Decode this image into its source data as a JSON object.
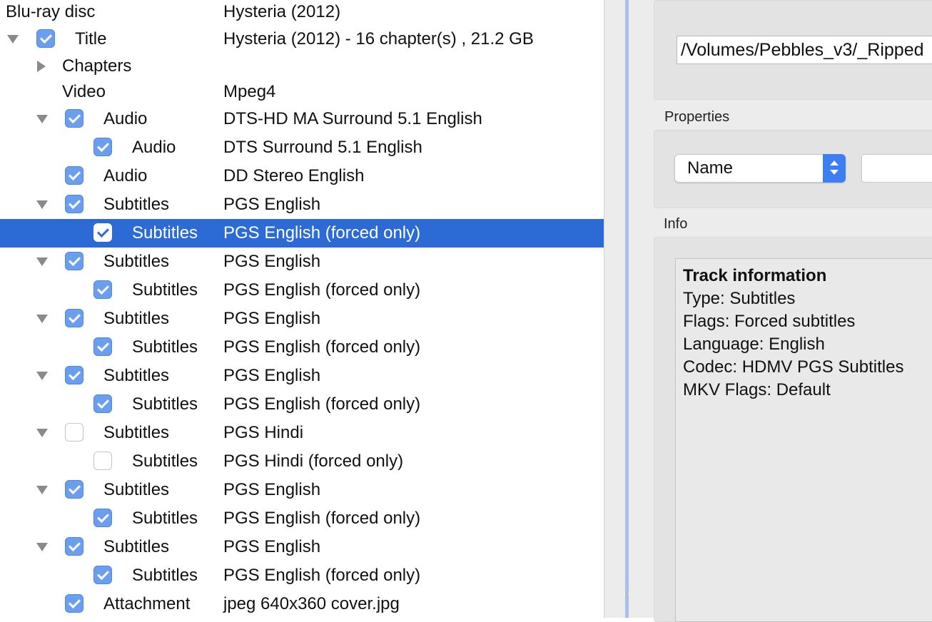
{
  "tree": {
    "rows": [
      {
        "disc": "none",
        "cb": "none",
        "label": "Blu-ray disc",
        "value": "Hysteria (2012)",
        "selected": false
      },
      {
        "disc": "open",
        "cb": "checked",
        "label": "Title",
        "value": "Hysteria (2012) - 16 chapter(s) , 21.2 GB",
        "selected": false
      },
      {
        "disc": "closed",
        "cb": "none",
        "label": "Chapters",
        "value": "",
        "selected": false
      },
      {
        "disc": "none",
        "cb": "none",
        "label": "Video",
        "value": "Mpeg4",
        "selected": false
      },
      {
        "disc": "open",
        "cb": "checked",
        "label": "Audio",
        "value": "DTS-HD MA Surround 5.1 English",
        "selected": false
      },
      {
        "disc": "none",
        "cb": "checked",
        "label": "Audio",
        "value": "DTS Surround 5.1 English",
        "selected": false
      },
      {
        "disc": "none",
        "cb": "checked",
        "label": "Audio",
        "value": "DD Stereo English",
        "selected": false
      },
      {
        "disc": "open",
        "cb": "checked",
        "label": "Subtitles",
        "value": "PGS English",
        "selected": false
      },
      {
        "disc": "none",
        "cb": "checked",
        "label": "Subtitles",
        "value": "PGS English  (forced only)",
        "selected": true
      },
      {
        "disc": "open",
        "cb": "checked",
        "label": "Subtitles",
        "value": "PGS English",
        "selected": false
      },
      {
        "disc": "none",
        "cb": "checked",
        "label": "Subtitles",
        "value": "PGS English  (forced only)",
        "selected": false
      },
      {
        "disc": "open",
        "cb": "checked",
        "label": "Subtitles",
        "value": "PGS English",
        "selected": false
      },
      {
        "disc": "none",
        "cb": "checked",
        "label": "Subtitles",
        "value": "PGS English  (forced only)",
        "selected": false
      },
      {
        "disc": "open",
        "cb": "checked",
        "label": "Subtitles",
        "value": "PGS English",
        "selected": false
      },
      {
        "disc": "none",
        "cb": "checked",
        "label": "Subtitles",
        "value": "PGS English  (forced only)",
        "selected": false
      },
      {
        "disc": "open",
        "cb": "unchecked",
        "label": "Subtitles",
        "value": "PGS Hindi",
        "selected": false
      },
      {
        "disc": "none",
        "cb": "unchecked",
        "label": "Subtitles",
        "value": "PGS Hindi  (forced only)",
        "selected": false
      },
      {
        "disc": "open",
        "cb": "checked",
        "label": "Subtitles",
        "value": "PGS English",
        "selected": false
      },
      {
        "disc": "none",
        "cb": "checked",
        "label": "Subtitles",
        "value": "PGS English  (forced only)",
        "selected": false
      },
      {
        "disc": "open",
        "cb": "checked",
        "label": "Subtitles",
        "value": "PGS English",
        "selected": false
      },
      {
        "disc": "none",
        "cb": "checked",
        "label": "Subtitles",
        "value": "PGS English  (forced only)",
        "selected": false
      },
      {
        "disc": "none",
        "cb": "checked",
        "label": "Attachment",
        "value": "jpeg 640x360 cover.jpg",
        "selected": false
      }
    ]
  },
  "output": {
    "path": "/Volumes/Pebbles_v3/_Ripped"
  },
  "properties": {
    "label": "Properties",
    "select_value": "Name",
    "value_field": ""
  },
  "info": {
    "label": "Info",
    "title": "Track information",
    "lines": [
      "Type: Subtitles",
      "Flags: Forced subtitles",
      "Language: English",
      "Codec: HDMV PGS Subtitles",
      "MKV Flags: Default"
    ]
  },
  "colors": {
    "selection": "#2c6bd5",
    "checkbox": "#6a9ff0",
    "accent": "#3d7ff2"
  }
}
